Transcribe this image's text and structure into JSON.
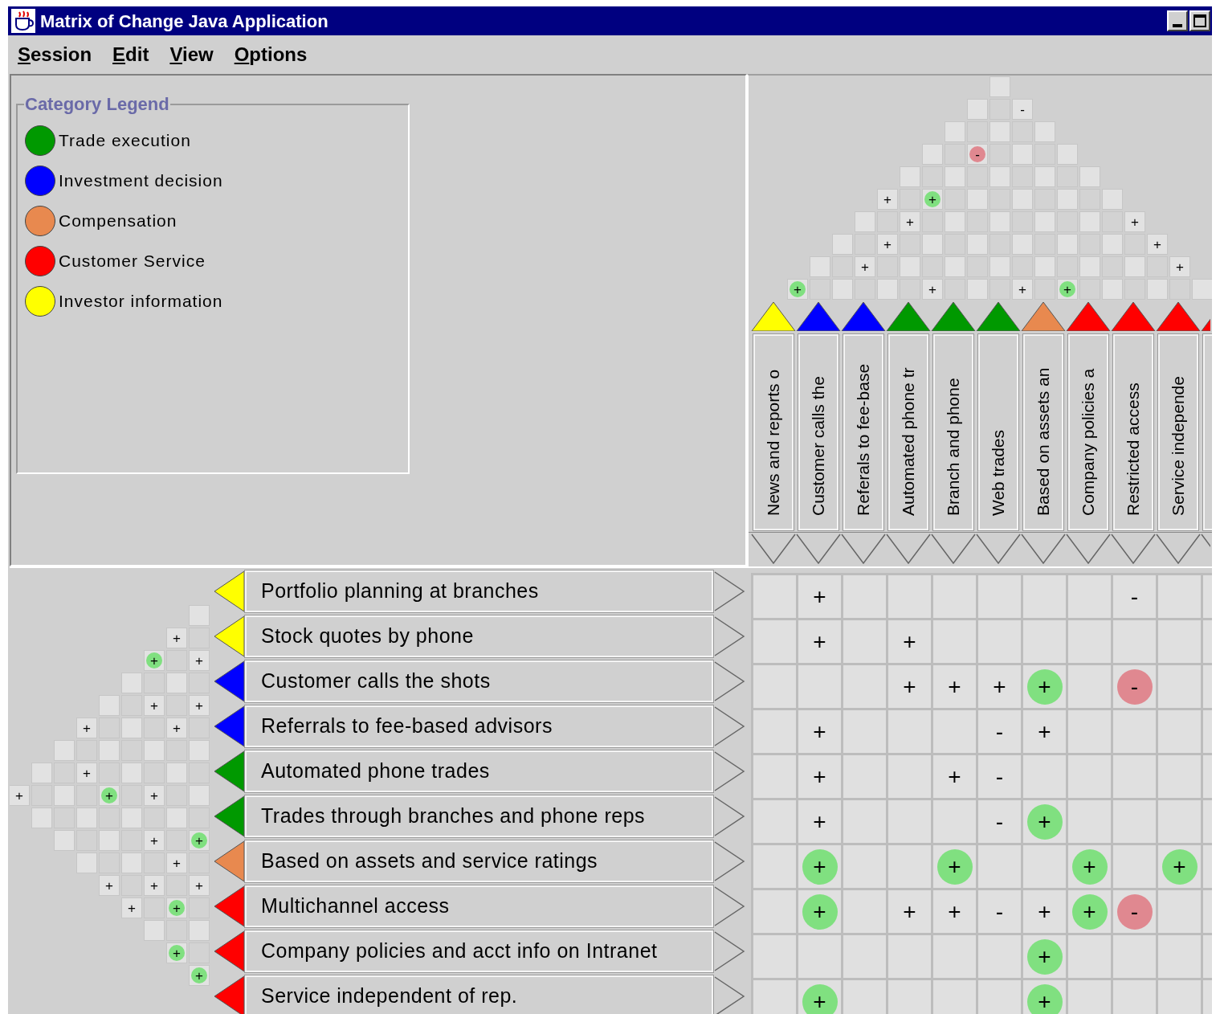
{
  "window": {
    "title": "Matrix of Change Java Application"
  },
  "menu": [
    "Session",
    "Edit",
    "View",
    "Options"
  ],
  "legend": {
    "title": "Category Legend",
    "items": [
      {
        "label": "Trade execution",
        "color": "#009900"
      },
      {
        "label": "Investment decision",
        "color": "#0000ff"
      },
      {
        "label": "Compensation",
        "color": "#e8894f"
      },
      {
        "label": "Customer Service",
        "color": "#ff0000"
      },
      {
        "label": "Investor information",
        "color": "#ffff00"
      }
    ]
  },
  "column_roof": {
    "levels": [
      {
        "cells": [
          null
        ]
      },
      {
        "cells": [
          null,
          {
            "sign": "-",
            "strong": false
          }
        ]
      },
      {
        "cells": [
          null,
          null,
          null
        ]
      },
      {
        "cells": [
          null,
          {
            "sign": "-",
            "strong": true,
            "color": "#e08890"
          },
          null,
          null
        ]
      },
      {
        "cells": [
          null,
          null,
          null,
          null,
          null
        ]
      },
      {
        "cells": [
          {
            "sign": "+",
            "strong": false
          },
          {
            "sign": "+",
            "strong": true,
            "color": "#80e080"
          },
          null,
          null,
          null,
          null
        ]
      },
      {
        "cells": [
          null,
          {
            "sign": "+",
            "strong": false
          },
          null,
          null,
          null,
          null,
          {
            "sign": "+",
            "strong": false
          }
        ]
      },
      {
        "cells": [
          null,
          {
            "sign": "+",
            "strong": false
          },
          null,
          null,
          null,
          null,
          null,
          {
            "sign": "+",
            "strong": false
          }
        ]
      },
      {
        "cells": [
          null,
          {
            "sign": "+",
            "strong": false
          },
          null,
          null,
          null,
          null,
          null,
          null,
          {
            "sign": "+",
            "strong": false
          }
        ]
      },
      {
        "cells": [
          {
            "sign": "+",
            "strong": true,
            "color": "#80e080"
          },
          null,
          null,
          {
            "sign": "+",
            "strong": false
          },
          null,
          {
            "sign": "+",
            "strong": false
          },
          {
            "sign": "+",
            "strong": true,
            "color": "#80e080"
          },
          null,
          null,
          null
        ]
      }
    ]
  },
  "columns": [
    {
      "label": "News and reports o",
      "color": "#ffff00"
    },
    {
      "label": "Customer calls the",
      "color": "#0000ff"
    },
    {
      "label": "Referals to fee-base",
      "color": "#0000ff"
    },
    {
      "label": "Automated phone tr",
      "color": "#009900"
    },
    {
      "label": "Branch and phone",
      "color": "#009900"
    },
    {
      "label": "Web trades",
      "color": "#009900"
    },
    {
      "label": "Based on assets an",
      "color": "#e8894f"
    },
    {
      "label": "Company policies a",
      "color": "#ff0000"
    },
    {
      "label": "Restricted access",
      "color": "#ff0000"
    },
    {
      "label": "Service independe",
      "color": "#ff0000"
    },
    {
      "color": "#ff0000"
    }
  ],
  "row_roof": {
    "levels": [
      {
        "cells": [
          {
            "sign": "+",
            "strong": false
          }
        ]
      },
      {
        "cells": [
          null,
          null
        ]
      },
      {
        "cells": [
          null,
          null,
          null
        ]
      },
      {
        "cells": [
          {
            "sign": "+",
            "strong": false
          },
          {
            "sign": "+",
            "strong": false
          },
          null,
          null
        ]
      },
      {
        "cells": [
          null,
          null,
          {
            "sign": "+",
            "strong": true,
            "color": "#80e080"
          },
          null,
          {
            "sign": "+",
            "strong": false
          }
        ]
      },
      {
        "cells": [
          null,
          null,
          null,
          null,
          null,
          {
            "sign": "+",
            "strong": false
          }
        ]
      },
      {
        "cells": [
          {
            "sign": "+",
            "strong": true,
            "color": "#80e080"
          },
          {
            "sign": "+",
            "strong": false
          },
          null,
          {
            "sign": "+",
            "strong": false
          },
          {
            "sign": "+",
            "strong": false
          },
          {
            "sign": "+",
            "strong": false
          },
          null
        ]
      },
      {
        "cells": [
          {
            "sign": "+",
            "strong": false
          },
          null,
          {
            "sign": "+",
            "strong": false
          },
          null,
          null,
          {
            "sign": "+",
            "strong": false
          },
          {
            "sign": "+",
            "strong": true,
            "color": "#80e080"
          },
          {
            "sign": "+",
            "strong": true,
            "color": "#80e080"
          }
        ]
      },
      {
        "cells": [
          null,
          {
            "sign": "+",
            "strong": false
          },
          {
            "sign": "+",
            "strong": false
          },
          null,
          null,
          {
            "sign": "+",
            "strong": true,
            "color": "#80e080"
          },
          {
            "sign": "+",
            "strong": false
          },
          null,
          {
            "sign": "+",
            "strong": true,
            "color": "#80e080"
          }
        ]
      }
    ]
  },
  "rows": [
    {
      "label": "Portfolio planning at branches",
      "color": "#ffff00",
      "cells": [
        null,
        {
          "sign": "+",
          "strong": false
        },
        null,
        null,
        null,
        null,
        null,
        null,
        {
          "sign": "-",
          "strong": false
        },
        null
      ]
    },
    {
      "label": "Stock quotes by phone",
      "color": "#ffff00",
      "cells": [
        null,
        {
          "sign": "+",
          "strong": false
        },
        null,
        {
          "sign": "+",
          "strong": false
        },
        null,
        null,
        null,
        null,
        null,
        null
      ]
    },
    {
      "label": "Customer calls the shots",
      "color": "#0000ff",
      "cells": [
        null,
        null,
        null,
        {
          "sign": "+",
          "strong": false
        },
        {
          "sign": "+",
          "strong": false
        },
        {
          "sign": "+",
          "strong": false
        },
        {
          "sign": "+",
          "strong": true,
          "color": "#80e080"
        },
        null,
        {
          "sign": "-",
          "strong": true,
          "color": "#e08890"
        },
        null
      ]
    },
    {
      "label": "Referrals to fee-based advisors",
      "color": "#0000ff",
      "cells": [
        null,
        {
          "sign": "+",
          "strong": false
        },
        null,
        null,
        null,
        {
          "sign": "-",
          "strong": false
        },
        {
          "sign": "+",
          "strong": false
        },
        null,
        null,
        null
      ]
    },
    {
      "label": "Automated phone trades",
      "color": "#009900",
      "cells": [
        null,
        {
          "sign": "+",
          "strong": false
        },
        null,
        null,
        {
          "sign": "+",
          "strong": false
        },
        {
          "sign": "-",
          "strong": false
        },
        null,
        null,
        null,
        null
      ]
    },
    {
      "label": "Trades through branches and phone reps",
      "color": "#009900",
      "cells": [
        null,
        {
          "sign": "+",
          "strong": false
        },
        null,
        null,
        null,
        {
          "sign": "-",
          "strong": false
        },
        {
          "sign": "+",
          "strong": true,
          "color": "#80e080"
        },
        null,
        null,
        null
      ]
    },
    {
      "label": "Based on assets and service ratings",
      "color": "#e8894f",
      "cells": [
        null,
        {
          "sign": "+",
          "strong": true,
          "color": "#80e080"
        },
        null,
        null,
        {
          "sign": "+",
          "strong": true,
          "color": "#80e080"
        },
        null,
        null,
        {
          "sign": "+",
          "strong": true,
          "color": "#80e080"
        },
        null,
        {
          "sign": "+",
          "strong": true,
          "color": "#80e080"
        }
      ]
    },
    {
      "label": "Multichannel access",
      "color": "#ff0000",
      "cells": [
        null,
        {
          "sign": "+",
          "strong": true,
          "color": "#80e080"
        },
        null,
        {
          "sign": "+",
          "strong": false
        },
        {
          "sign": "+",
          "strong": false
        },
        {
          "sign": "-",
          "strong": false
        },
        {
          "sign": "+",
          "strong": false
        },
        {
          "sign": "+",
          "strong": true,
          "color": "#80e080"
        },
        {
          "sign": "-",
          "strong": true,
          "color": "#e08890"
        },
        null
      ]
    },
    {
      "label": "Company policies and acct info on Intranet",
      "color": "#ff0000",
      "cells": [
        null,
        null,
        null,
        null,
        null,
        null,
        {
          "sign": "+",
          "strong": true,
          "color": "#80e080"
        },
        null,
        null,
        null
      ]
    },
    {
      "label": "Service independent of rep.",
      "color": "#ff0000",
      "cells": [
        null,
        {
          "sign": "+",
          "strong": true,
          "color": "#80e080"
        },
        null,
        null,
        null,
        null,
        {
          "sign": "+",
          "strong": true,
          "color": "#80e080"
        },
        null,
        null,
        null
      ]
    }
  ]
}
